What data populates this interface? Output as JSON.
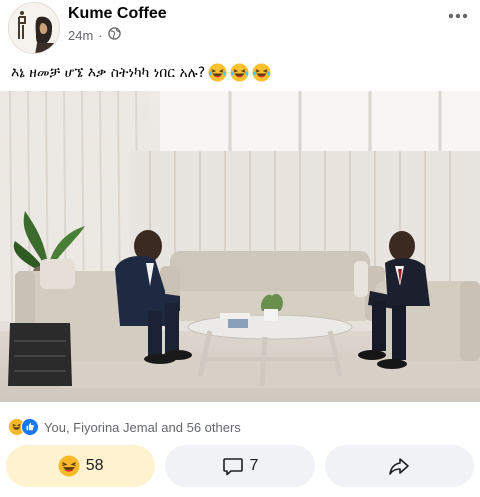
{
  "post": {
    "author": "Kume Coffee",
    "time": "24m",
    "dot": "·",
    "privacy_icon": "globe-icon",
    "more_icon": "more-dots-icon",
    "caption": "እኔ ዘመቻ ሆኜ እቃ ስትነካካ ነበር አሉ?",
    "caption_emojis": [
      "laughing-emoji",
      "laughing-emoji",
      "laughing-emoji"
    ]
  },
  "reactions": {
    "icons": [
      "haha-reaction-icon",
      "like-reaction-icon"
    ],
    "summary": "You, Fiyorina Jemal and 56 others"
  },
  "actions": {
    "like_count": "58",
    "comment_count": "7",
    "like_icon": "haha-reaction-icon",
    "comment_icon": "comment-icon",
    "share_icon": "share-icon"
  },
  "colors": {
    "like_bg": "#fff3cf",
    "button_bg": "#f0f2f5",
    "meta_text": "#65676b",
    "haha_yellow": "#f7b928",
    "like_blue": "#1877f2"
  }
}
